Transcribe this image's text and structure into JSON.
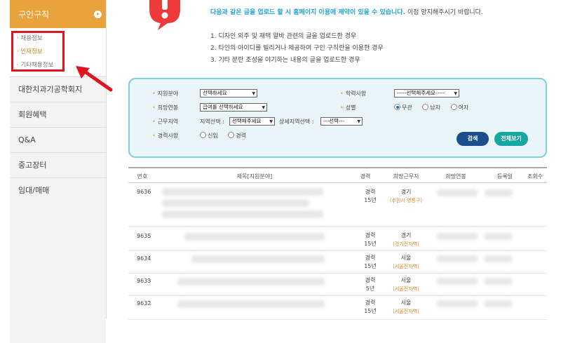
{
  "sidebar": {
    "header": "구인구직",
    "sub_items": [
      {
        "label": "· 채용정보",
        "active": false
      },
      {
        "label": "· 인재정보",
        "active": true
      },
      {
        "label": "· 기타채용정보",
        "active": false
      }
    ],
    "items": [
      "대한치과기공학회지",
      "회원혜택",
      "Q&A",
      "중고장터",
      "임대/매매"
    ]
  },
  "notice": {
    "line1_blue": "다음과 같은 글을 업로드 할 시 홈페이지 이용에 제약이 있을 수 있습니다.",
    "line1_rest": " 이점 양지해주시기 바랍니다.",
    "rules": [
      "1. 디자인 외주 및 재택 알바 관련의 글을 업로드한 경우",
      "2. 타인의 아이디를 빌리거나 제공하여 구인 구직란을 이용한 경우",
      "3. 기타 분란 조성을 야기하는 내용의 글을 업로드한 경우"
    ]
  },
  "search": {
    "field_label": "지원분야",
    "field_value": "선택하세요",
    "education_label": "학력사항",
    "education_value": "-----선택해주세요-----",
    "salary_label": "희망연봉",
    "salary_value": "급여를 선택하세요",
    "gender_label": "성별",
    "gender_options": [
      "무관",
      "남자",
      "여자"
    ],
    "region_label": "근무지역",
    "region_select_label": "지역선택 :",
    "region_value": "선택해주세요",
    "detail_region_label": "상세지역선택 :",
    "detail_region_value": "---선택---",
    "career_label": "경력사항",
    "career_options": [
      "신입",
      "경력"
    ],
    "search_button": "검색",
    "view_all_button": "전체보기"
  },
  "table": {
    "headers": [
      "번호",
      "제목[지원분야]",
      "경력",
      "희망근무지",
      "희망연봉",
      "등록일",
      "조회수"
    ],
    "rows": [
      {
        "num": "9636",
        "exp_label": "경력",
        "exp_years": "15년",
        "loc": "경기",
        "loc_sub": "(수원시 영통구)"
      },
      {
        "num": "9635",
        "exp_label": "경력",
        "exp_years": "15년",
        "loc": "경기",
        "loc_sub": "(경기전지역)"
      },
      {
        "num": "9634",
        "exp_label": "경력",
        "exp_years": "15년",
        "loc": "서울",
        "loc_sub": "(서울전지역)"
      },
      {
        "num": "9633",
        "exp_label": "경력",
        "exp_years": "5년",
        "loc": "서울",
        "loc_sub": "(서울전지역)"
      },
      {
        "num": "9632",
        "exp_label": "경력",
        "exp_years": "15년",
        "loc": "서울",
        "loc_sub": "(서울전지역)"
      }
    ]
  },
  "colors": {
    "accent_orange": "#e8a33c",
    "highlight_red": "#e0141f",
    "panel_border": "#7cd0e2",
    "notice_blue": "#1fa4d9",
    "search_button": "#1b4f8c",
    "view_all_button": "#15a8a0"
  }
}
